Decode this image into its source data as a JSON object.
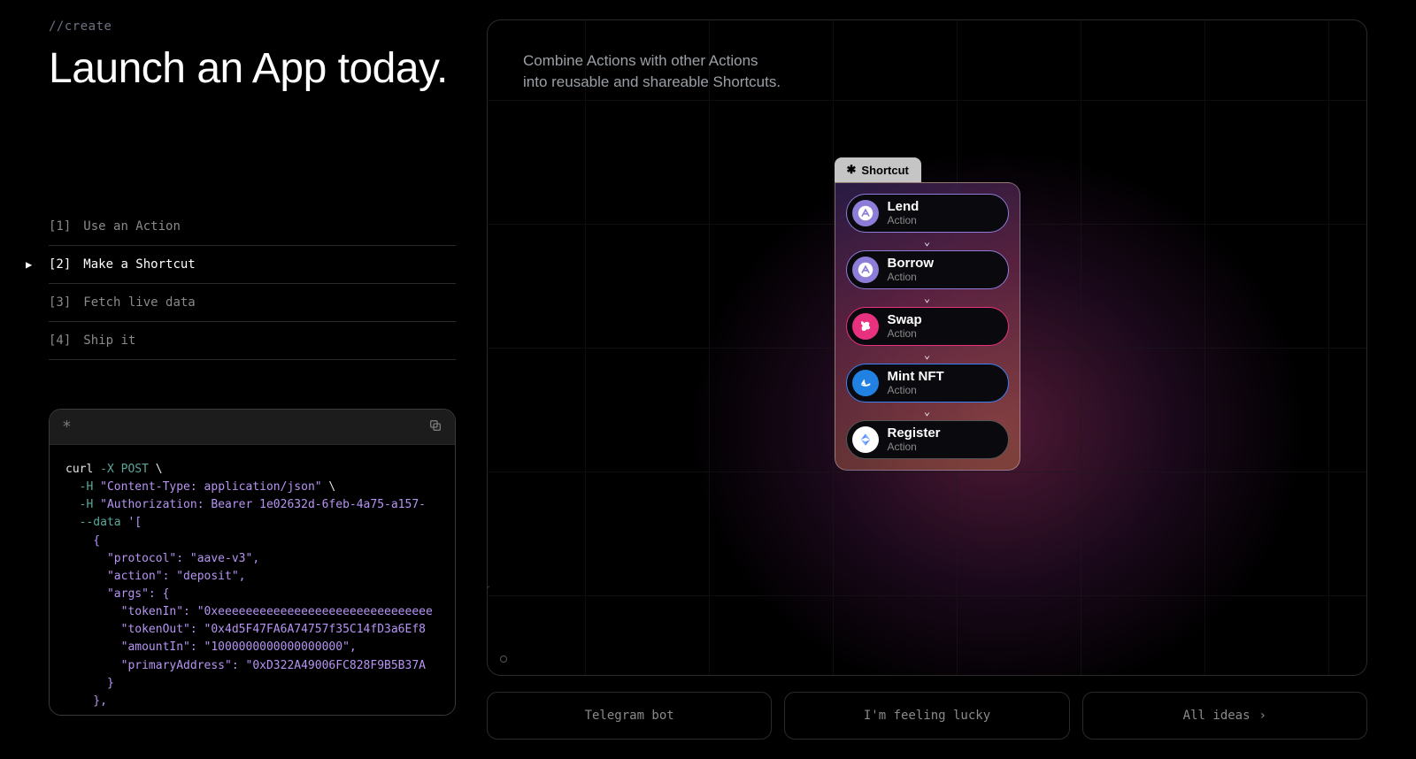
{
  "eyebrow": "//create",
  "headline": "Launch an App today.",
  "steps": [
    {
      "num": "[1]",
      "label": "Use an Action"
    },
    {
      "num": "[2]",
      "label": "Make a Shortcut",
      "active": true
    },
    {
      "num": "[3]",
      "label": "Fetch live data"
    },
    {
      "num": "[4]",
      "label": "Ship it"
    }
  ],
  "code_tokens": [
    [
      {
        "t": "curl",
        "c": "cmd"
      },
      {
        "t": " -X POST",
        "c": "flag"
      },
      {
        "t": " \\",
        "c": "cmd"
      }
    ],
    [
      {
        "t": "  -H ",
        "c": "flag"
      },
      {
        "t": "\"Content-Type: application/json\"",
        "c": "str"
      },
      {
        "t": " \\",
        "c": "cmd"
      }
    ],
    [
      {
        "t": "  -H ",
        "c": "flag"
      },
      {
        "t": "\"Authorization: Bearer 1e02632d-6feb-4a75-a157-",
        "c": "str"
      }
    ],
    [
      {
        "t": "  --data ",
        "c": "flag"
      },
      {
        "t": "'[",
        "c": "str"
      }
    ],
    [
      {
        "t": "    {",
        "c": "str"
      }
    ],
    [
      {
        "t": "      \"protocol\": \"aave-v3\",",
        "c": "str"
      }
    ],
    [
      {
        "t": "      \"action\": \"deposit\",",
        "c": "str"
      }
    ],
    [
      {
        "t": "      \"args\": {",
        "c": "str"
      }
    ],
    [
      {
        "t": "        \"tokenIn\": \"0xeeeeeeeeeeeeeeeeeeeeeeeeeeeeeee",
        "c": "str"
      }
    ],
    [
      {
        "t": "        \"tokenOut\": \"0x4d5F47FA6A74757f35C14fD3a6Ef8",
        "c": "str"
      }
    ],
    [
      {
        "t": "        \"amountIn\": \"1000000000000000000\",",
        "c": "str"
      }
    ],
    [
      {
        "t": "        \"primaryAddress\": \"0xD322A49006FC828F9B5B37A",
        "c": "str"
      }
    ],
    [
      {
        "t": "      }",
        "c": "str"
      }
    ],
    [
      {
        "t": "    },",
        "c": "str"
      }
    ]
  ],
  "canvas_desc_line1": "Combine Actions with other Actions",
  "canvas_desc_line2": "into reusable and shareable Shortcuts.",
  "shortcut_label": "Shortcut",
  "action_sub": "Action",
  "pills": [
    {
      "name": "Lend",
      "border": "#8d7dd9",
      "bg": "#8d7dd9",
      "svg": "aave"
    },
    {
      "name": "Borrow",
      "border": "#8d7dd9",
      "bg": "#8d7dd9",
      "svg": "aave"
    },
    {
      "name": "Swap",
      "border": "#e8317f",
      "bg": "#e8317f",
      "svg": "uni"
    },
    {
      "name": "Mint NFT",
      "border": "#3b82f6",
      "bg": "#2081e2",
      "svg": "sea"
    },
    {
      "name": "Register",
      "border": "#555",
      "bg": "#fff",
      "svg": "ens"
    }
  ],
  "btn1": "Telegram bot",
  "btn2": "I'm feeling lucky",
  "btn3": "All ideas"
}
